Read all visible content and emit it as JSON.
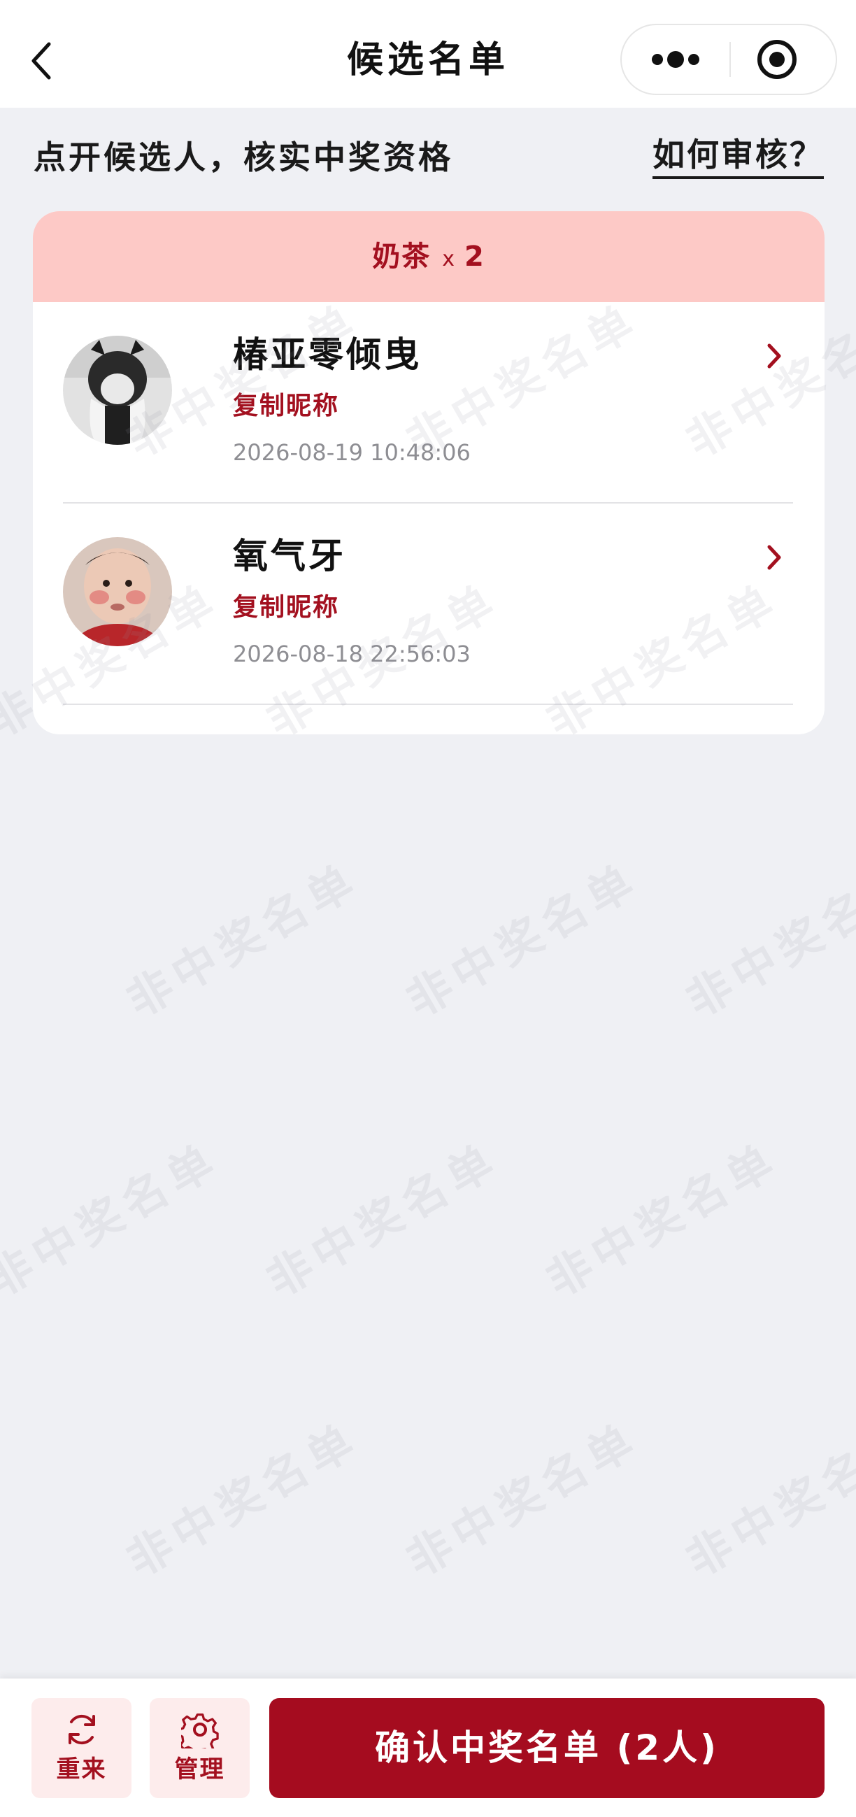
{
  "nav": {
    "title": "候选名单"
  },
  "hint": {
    "text": "点开候选人，核实中奖资格",
    "link": "如何审核？"
  },
  "prize": {
    "name": "奶茶",
    "multiplier": "x",
    "count": "2"
  },
  "candidates": [
    {
      "name": "椿亚零倾曳",
      "copy_label": "复制昵称",
      "time": "2026-08-19 10:48:06"
    },
    {
      "name": "氧气牙",
      "copy_label": "复制昵称",
      "time": "2026-08-18 22:56:03"
    }
  ],
  "watermark": "非中奖名单",
  "toolbar": {
    "restart_label": "重来",
    "manage_label": "管理",
    "confirm_label": "确认中奖名单 (2人)"
  },
  "colors": {
    "accent": "#a50c1f",
    "prize_header_bg": "#fdc9c6",
    "page_bg": "#eff0f4"
  }
}
